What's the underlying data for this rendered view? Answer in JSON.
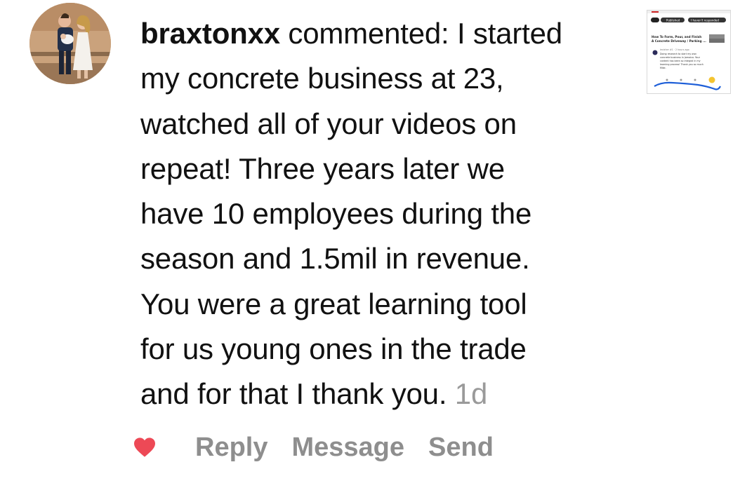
{
  "comment": {
    "username": "braxtonxx",
    "action_text": " commented: I started",
    "lines": [
      "my concrete business at 23,",
      "watched all of your videos on",
      "repeat! Three years later we",
      "have 10 employees during the",
      "season and 1.5mil in revenue.",
      "You were a great learning tool",
      "for us young ones in the trade",
      "and for that I thank you."
    ],
    "age": "1d"
  },
  "post_thumbnail": {
    "pills": [
      "Published",
      "I haven't responded"
    ],
    "title": "How To Form, Pour, and Finish A Concrete Driveway / Parking ...",
    "author": "lexisher #1 · 2 hours ago",
    "text": "Doing research to start my own concrete business in Jamaica. Your content has been so integral in my learning process! Thank you so much Mike."
  },
  "actions": {
    "reply": "Reply",
    "message": "Message",
    "send": "Send"
  },
  "colors": {
    "heart": "#ed4956",
    "secondary_text": "#8e8e8e",
    "age_text": "#9a9a9a"
  }
}
